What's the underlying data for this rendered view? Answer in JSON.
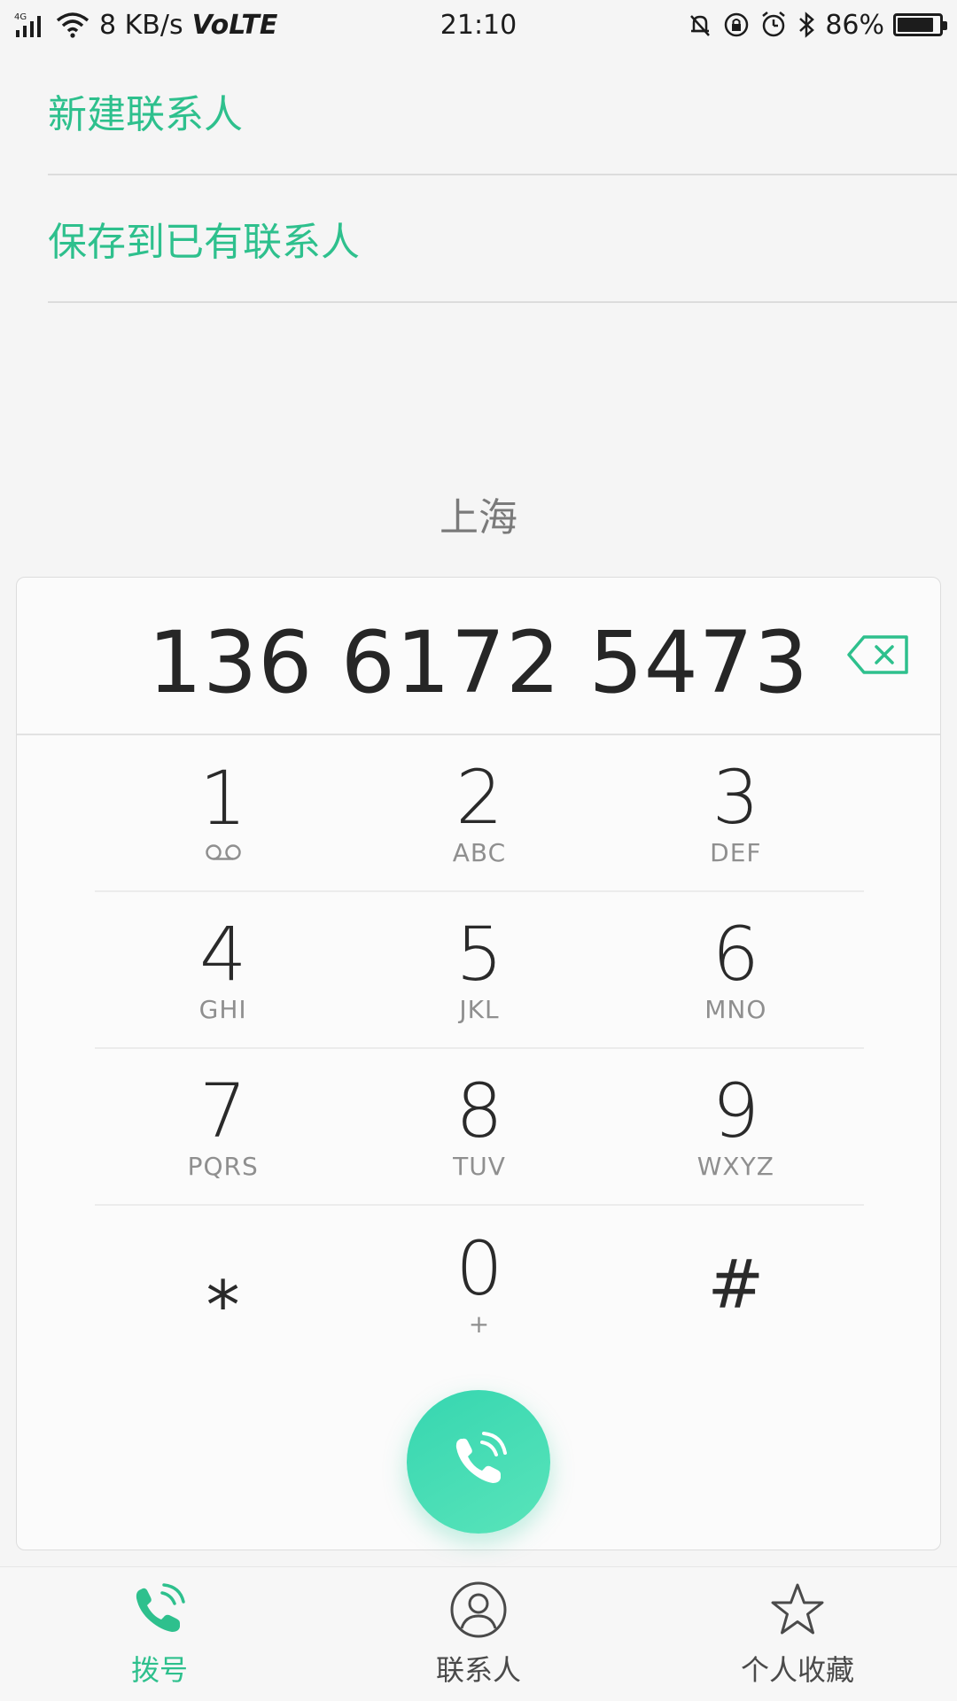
{
  "status_bar": {
    "network": "4G",
    "speed": "8 KB/s",
    "volte": "VoLTE",
    "time": "21:10",
    "battery_percent": "86%",
    "battery_level": 0.86
  },
  "options": {
    "new_contact": "新建联系人",
    "save_existing": "保存到已有联系人"
  },
  "location": "上海",
  "dialer": {
    "number": "136 6172 5473"
  },
  "keypad": {
    "rows": [
      [
        {
          "digit": "1",
          "sub": ""
        },
        {
          "digit": "2",
          "sub": "ABC"
        },
        {
          "digit": "3",
          "sub": "DEF"
        }
      ],
      [
        {
          "digit": "4",
          "sub": "GHI"
        },
        {
          "digit": "5",
          "sub": "JKL"
        },
        {
          "digit": "6",
          "sub": "MNO"
        }
      ],
      [
        {
          "digit": "7",
          "sub": "PQRS"
        },
        {
          "digit": "8",
          "sub": "TUV"
        },
        {
          "digit": "9",
          "sub": "WXYZ"
        }
      ],
      [
        {
          "digit": "⁎",
          "sub": ""
        },
        {
          "digit": "0",
          "sub": "+"
        },
        {
          "digit": "#",
          "sub": ""
        }
      ]
    ]
  },
  "bottom_nav": {
    "items": [
      {
        "label": "拨号",
        "icon": "phone-icon",
        "active": true
      },
      {
        "label": "联系人",
        "icon": "person-icon",
        "active": false
      },
      {
        "label": "个人收藏",
        "icon": "star-icon",
        "active": false
      }
    ]
  },
  "colors": {
    "accent": "#2ec08d",
    "call_gradient_start": "#36d6b0",
    "call_gradient_end": "#59e4ba"
  }
}
